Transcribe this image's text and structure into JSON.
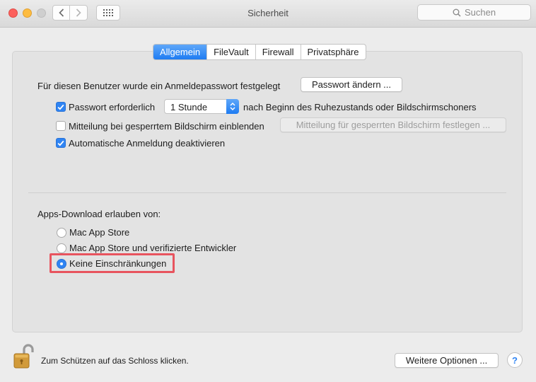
{
  "window": {
    "title": "Sicherheit",
    "search_placeholder": "Suchen"
  },
  "tabs": [
    {
      "label": "Allgemein",
      "active": true
    },
    {
      "label": "FileVault",
      "active": false
    },
    {
      "label": "Firewall",
      "active": false
    },
    {
      "label": "Privatsphäre",
      "active": false
    }
  ],
  "general": {
    "password_set_text": "Für diesen Benutzer wurde ein Anmeldepasswort festgelegt",
    "change_password_button": "Passwort ändern ...",
    "require_password": {
      "label": "Passwort erforderlich",
      "checked": true
    },
    "require_password_delay": "1 Stunde",
    "require_password_suffix": "nach Beginn des Ruhezustands oder Bildschirmschoners",
    "lock_message": {
      "label": "Mitteilung bei gesperrtem Bildschirm einblenden",
      "checked": false
    },
    "lock_message_button": "Mitteilung für gesperrten Bildschirm festlegen ...",
    "auto_login": {
      "label": "Automatische Anmeldung deaktivieren",
      "checked": true
    }
  },
  "downloads": {
    "heading": "Apps-Download erlauben von:",
    "options": [
      {
        "label": "Mac App Store",
        "selected": false
      },
      {
        "label": "Mac App Store und verifizierte Entwickler",
        "selected": false
      },
      {
        "label": "Keine Einschränkungen",
        "selected": true
      }
    ]
  },
  "footer": {
    "lock_text": "Zum Schützen auf das Schloss klicken.",
    "advanced_button": "Weitere Optionen ...",
    "help_label": "?"
  },
  "colors": {
    "accent": "#2f84f3",
    "highlight": "#e8545e"
  }
}
